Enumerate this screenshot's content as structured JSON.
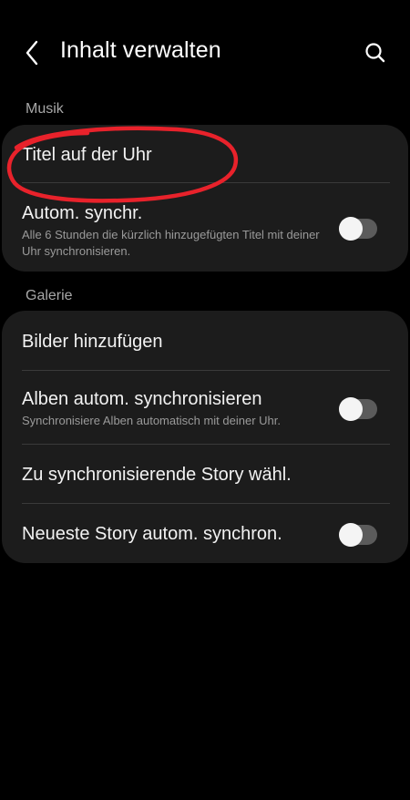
{
  "header": {
    "title": "Inhalt verwalten",
    "back_icon": "chevron-left-icon",
    "search_icon": "search-icon"
  },
  "sections": {
    "music": {
      "label": "Musik",
      "items": [
        {
          "title": "Titel auf der Uhr"
        },
        {
          "title": "Autom. synchr.",
          "subtitle": "Alle 6 Stunden die kürzlich hinzugefügten Titel mit deiner Uhr synchronisieren.",
          "toggle": false
        }
      ]
    },
    "gallery": {
      "label": "Galerie",
      "items": [
        {
          "title": "Bilder hinzufügen"
        },
        {
          "title": "Alben autom. synchronisieren",
          "subtitle": "Synchronisiere Alben automatisch mit deiner Uhr.",
          "toggle": false
        },
        {
          "title": "Zu synchronisierende Story wähl."
        },
        {
          "title": "Neueste Story autom. synchron.",
          "toggle": false
        }
      ]
    }
  },
  "colors": {
    "background": "#000000",
    "card": "#1c1c1c",
    "annotation": "#e8222b",
    "toggle_off": "#5b5b5b"
  }
}
